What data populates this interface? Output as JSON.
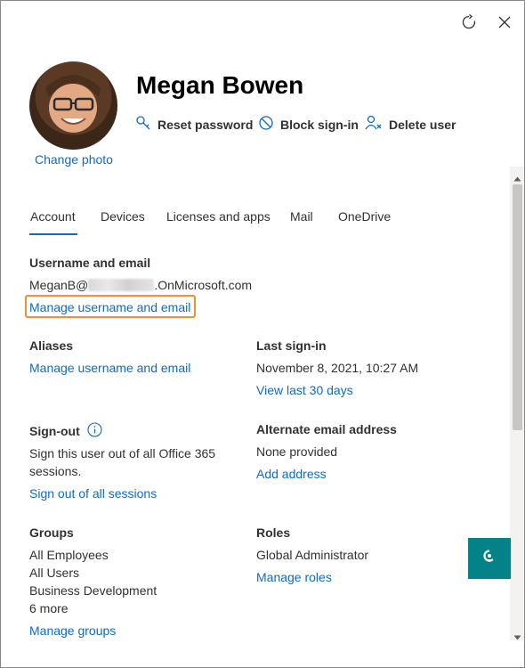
{
  "user": {
    "name": "Megan Bowen",
    "change_photo": "Change photo"
  },
  "actions": {
    "reset_password": "Reset password",
    "block_signin": "Block sign-in",
    "delete_user": "Delete user"
  },
  "tabs": [
    {
      "label": "Account",
      "active": true
    },
    {
      "label": "Devices"
    },
    {
      "label": "Licenses and apps"
    },
    {
      "label": "Mail"
    },
    {
      "label": "OneDrive"
    }
  ],
  "account": {
    "username_section": {
      "label": "Username and email",
      "value_prefix": "MeganB@",
      "value_suffix": ".OnMicrosoft.com",
      "manage_link": "Manage username and email"
    },
    "aliases": {
      "label": "Aliases",
      "manage_link": "Manage username and email"
    },
    "last_signin": {
      "label": "Last sign-in",
      "value": "November 8, 2021, 10:27 AM",
      "link": "View last 30 days"
    },
    "sign_out": {
      "label": "Sign-out",
      "description_line1": "Sign this user out of all Office 365",
      "description_line2": "sessions.",
      "link": "Sign out of all sessions"
    },
    "alternate_email": {
      "label": "Alternate email address",
      "value": "None provided",
      "link": "Add address"
    },
    "groups": {
      "label": "Groups",
      "items": [
        "All Employees",
        "All Users",
        "Business Development",
        "6 more"
      ],
      "link": "Manage groups"
    },
    "roles": {
      "label": "Roles",
      "value": "Global Administrator",
      "link": "Manage roles"
    }
  },
  "colors": {
    "link": "#0f6cbd",
    "highlight": "#f5902e",
    "fab": "#038387"
  }
}
